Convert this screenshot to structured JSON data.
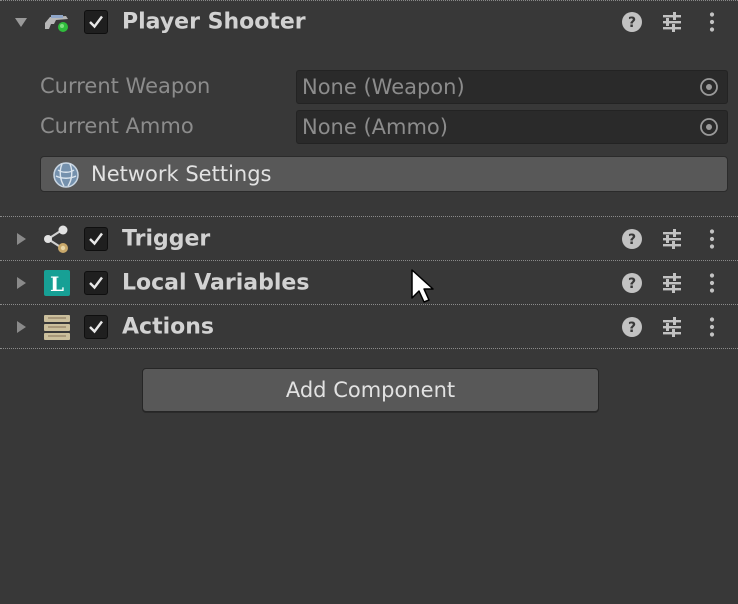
{
  "components": [
    {
      "title": "Player Shooter",
      "expanded": true,
      "enabled": true,
      "icon": "player-shooter-icon"
    },
    {
      "title": "Trigger",
      "expanded": false,
      "enabled": true,
      "icon": "trigger-icon"
    },
    {
      "title": "Local Variables",
      "expanded": false,
      "enabled": true,
      "icon": "local-variables-icon",
      "icon_letter": "L"
    },
    {
      "title": "Actions",
      "expanded": false,
      "enabled": true,
      "icon": "actions-icon"
    }
  ],
  "player_shooter": {
    "fields": [
      {
        "label": "Current Weapon",
        "value": "None (Weapon)"
      },
      {
        "label": "Current Ammo",
        "value": "None (Ammo)"
      }
    ],
    "network_button": "Network Settings"
  },
  "add_component_label": "Add Component",
  "colors": {
    "background": "#383838",
    "field_background": "#2a2a2a",
    "button_background": "#585858",
    "local_variables_teal": "#17a095"
  }
}
